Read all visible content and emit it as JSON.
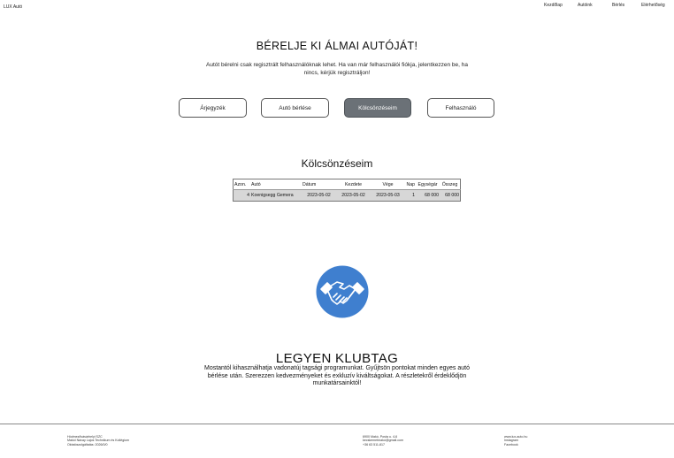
{
  "header": {
    "brand": "LUX Autó",
    "nav": [
      "Kezdőlap",
      "Autóink",
      "Bérlés",
      "Elérhetőség"
    ]
  },
  "hero": {
    "title": "BÉRELJE KI ÁLMAI AUTÓJÁT!",
    "text": "Autót bérelni csak regisztrált felhasználóknak lehet. Ha van már felhasználói fiókja, jelentkezzen be, ha nincs, kérjük regisztráljon!"
  },
  "buttons": {
    "prices": "Árjegyzék",
    "rent": "Autó bérlése",
    "my_rentals": "Kölcsönzéseim",
    "user": "Felhasználó",
    "active": "my_rentals"
  },
  "rentals": {
    "title": "Kölcsönzéseim",
    "columns": [
      "Azon.",
      "Autó",
      "Dátum",
      "Kezdete",
      "Vége",
      "Nap",
      "Egységár",
      "Összeg"
    ],
    "rows": [
      [
        "4",
        "Koenigsegg Gemera",
        "2023-05-02",
        "2023-05-02",
        "2023-05-03",
        "1",
        "68 000",
        "68 000"
      ]
    ]
  },
  "club": {
    "logo": "handshake-icon",
    "logo_color": "#3f7fcf",
    "title": "LEGYEN KLUBTAG",
    "text": "Mostantól kihasználhatja vadonatúj tagsági programunkat. Gyűjtsön pontokat minden egyes autó bérlése után. Szerezzen kedvezményeket és exkluzív kiváltságokat. A részletekről érdeklődjön munkatársainktól!"
  },
  "footer": {
    "col1": [
      "Hódmezővásárhelyi SZC",
      "Makói Návay Lajos Technikum és Kollégium",
      "Oktatószolgáltatás: 2026/0/0"
    ],
    "col2": [
      "6900 Makó, Posta u. 4-6",
      "kecskemetmakó@gmail.com",
      "+36 63 511-817"
    ],
    "col3": [
      "www.lux-auto.hu",
      "Instagram",
      "Facebook"
    ]
  }
}
